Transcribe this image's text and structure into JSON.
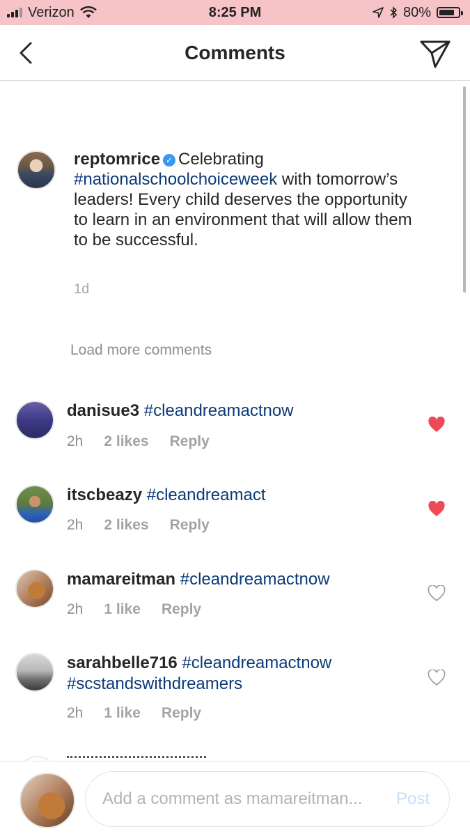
{
  "status_bar": {
    "carrier": "Verizon",
    "time": "8:25 PM",
    "battery": "80%",
    "battery_level": 0.8
  },
  "nav": {
    "title": "Comments"
  },
  "caption": {
    "username": "reptomrice",
    "text_before": "Celebrating",
    "hashtag": "#nationalschoolchoiceweek",
    "text_after": "with tomorrow’s leaders! Every child deserves the opportunity to learn in an environment that will allow them to be successful.",
    "time": "1d"
  },
  "load_more": "Load more comments",
  "comments": [
    {
      "username": "danisue3",
      "hashtag": "#cleandreamactnow",
      "hashtag2": "",
      "time": "2h",
      "likes": "2 likes",
      "reply": "Reply",
      "liked": true
    },
    {
      "username": "itscbeazy",
      "hashtag": "#cleandreamact",
      "hashtag2": "",
      "time": "2h",
      "likes": "2 likes",
      "reply": "Reply",
      "liked": true
    },
    {
      "username": "mamareitman",
      "hashtag": "#cleandreamactnow",
      "hashtag2": "",
      "time": "2h",
      "likes": "1 like",
      "reply": "Reply",
      "liked": false
    },
    {
      "username": "sarahbelle716",
      "hashtag": "#cleandreamactnow",
      "hashtag2": "#scstandswithdreamers",
      "time": "2h",
      "likes": "1 like",
      "reply": "Reply",
      "liked": false
    }
  ],
  "composer": {
    "placeholder": "Add a comment as mamareitman...",
    "post_label": "Post"
  },
  "colors": {
    "status_bar_bg": "#f6c3c6",
    "hashtag": "#0b3a78",
    "heart_liked": "#ed4956",
    "verified": "#3897f0",
    "post_disabled": "#c7e1fb"
  },
  "icons": [
    "signal-icon",
    "wifi-icon",
    "location-arrow-icon",
    "bluetooth-icon",
    "battery-icon",
    "back-chevron-icon",
    "direct-share-icon",
    "verified-badge-icon",
    "heart-icon"
  ]
}
